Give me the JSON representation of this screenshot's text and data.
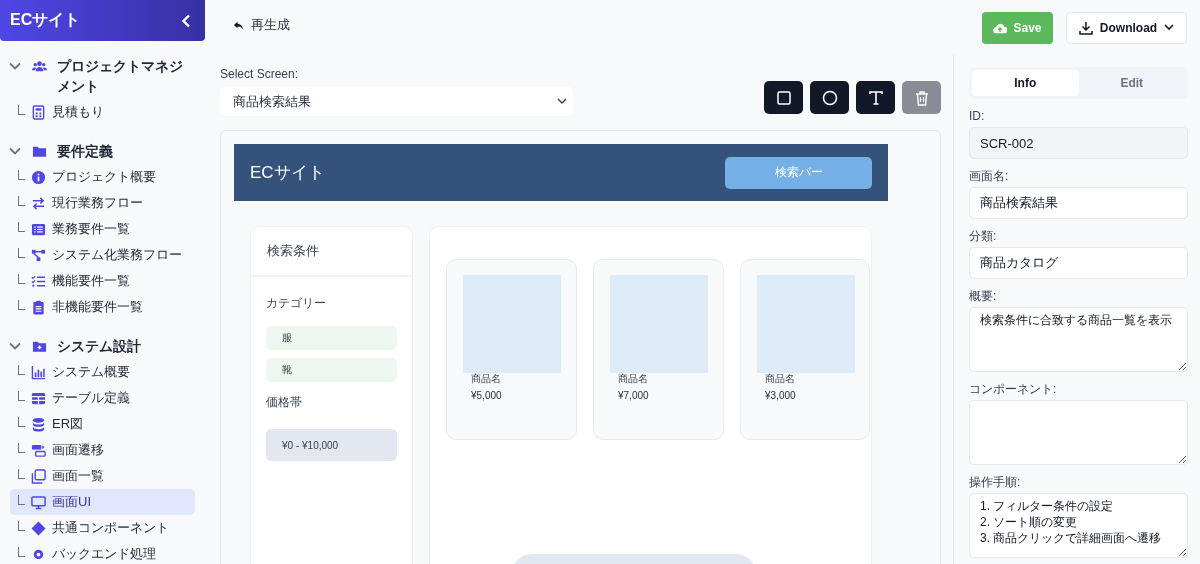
{
  "sidebar": {
    "title": "ECサイト",
    "sections": [
      {
        "label": "プロジェクトマネジメント",
        "expanded": true,
        "children": [
          {
            "label": "見積もり",
            "selected": false
          }
        ]
      },
      {
        "label": "要件定義",
        "expanded": true,
        "children": [
          {
            "label": "プロジェクト概要",
            "selected": false
          },
          {
            "label": "現行業務フロー",
            "selected": false
          },
          {
            "label": "業務要件一覧",
            "selected": false
          },
          {
            "label": "システム化業務フロー",
            "selected": false
          },
          {
            "label": "機能要件一覧",
            "selected": false
          },
          {
            "label": "非機能要件一覧",
            "selected": false
          }
        ]
      },
      {
        "label": "システム設計",
        "expanded": true,
        "children": [
          {
            "label": "システム概要",
            "selected": false
          },
          {
            "label": "テーブル定義",
            "selected": false
          },
          {
            "label": "ER図",
            "selected": false
          },
          {
            "label": "画面遷移",
            "selected": false
          },
          {
            "label": "画面一覧",
            "selected": false
          },
          {
            "label": "画面UI",
            "selected": true
          },
          {
            "label": "共通コンポーネント",
            "selected": false
          },
          {
            "label": "バックエンド処理",
            "selected": false
          }
        ]
      }
    ]
  },
  "toolbar": {
    "regenerate": "再生成",
    "save": "Save",
    "download": "Download"
  },
  "screen_select": {
    "label": "Select Screen:",
    "value": "商品検索結果"
  },
  "tools": [
    {
      "kind": "rect",
      "disabled": false
    },
    {
      "kind": "circle",
      "disabled": false
    },
    {
      "kind": "text",
      "disabled": false
    },
    {
      "kind": "delete",
      "disabled": true
    }
  ],
  "mockup": {
    "header_title": "ECサイト",
    "search_bar": "検索バー",
    "filter_title": "検索条件",
    "category_label": "カテゴリー",
    "categories": [
      "服",
      "靴"
    ],
    "price_label": "価格帯",
    "price_range": "¥0 - ¥10,000",
    "products": [
      {
        "name": "商品名",
        "price": "¥5,000"
      },
      {
        "name": "商品名",
        "price": "¥7,000"
      },
      {
        "name": "商品名",
        "price": "¥3,000"
      }
    ]
  },
  "panel": {
    "tabs": [
      {
        "label": "Info",
        "selected": true
      },
      {
        "label": "Edit",
        "selected": false
      }
    ],
    "fields": [
      {
        "kind": "readonly",
        "label": "ID:",
        "value": "SCR-002"
      },
      {
        "kind": "input",
        "label": "画面名:",
        "value": "商品検索結果"
      },
      {
        "kind": "input",
        "label": "分類:",
        "value": "商品カタログ"
      },
      {
        "kind": "textarea",
        "label": "概要:",
        "value": "検索条件に合致する商品一覧を表示"
      },
      {
        "kind": "textarea",
        "label": "コンポーネント:"
      },
      {
        "kind": "textarea",
        "label": "操作手順:",
        "value": "1. フィルター条件の設定\n2. ソート順の変更\n3. 商品クリックで詳細画面へ遷移"
      }
    ]
  }
}
